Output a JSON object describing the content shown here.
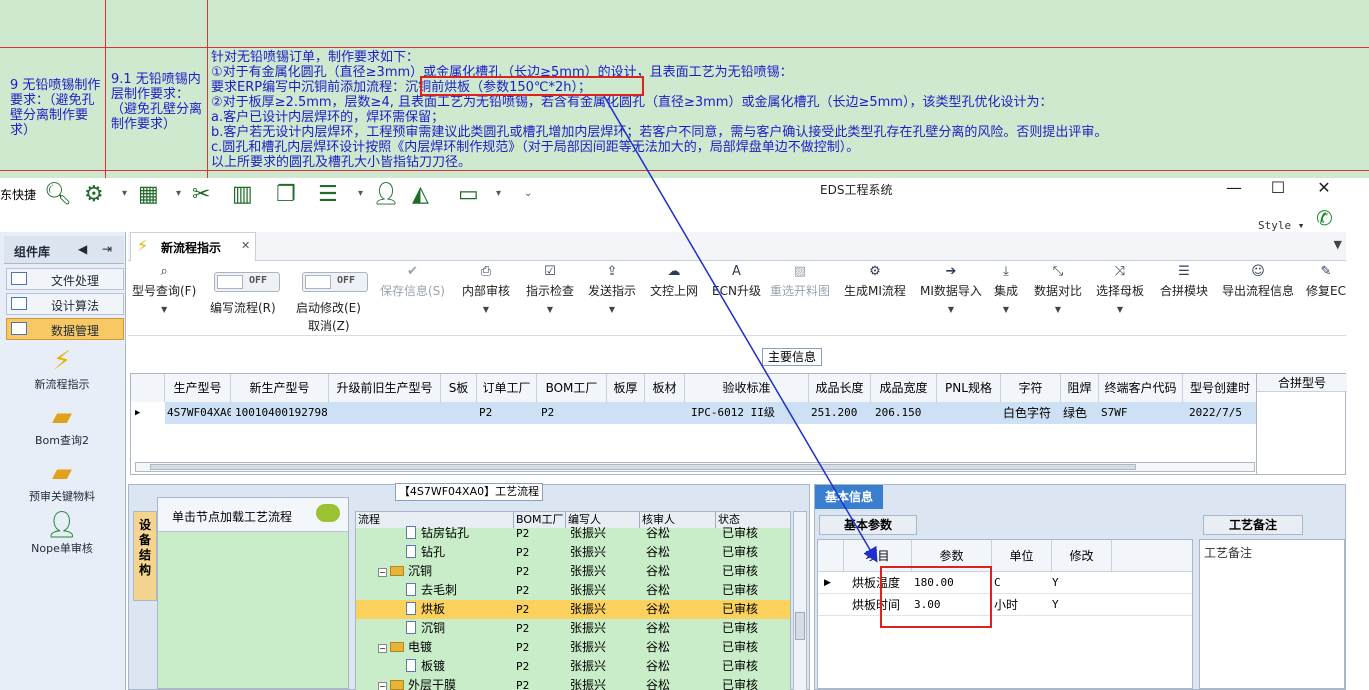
{
  "sheet": {
    "col1_text": "9 无铅喷锡制作要求：（避免孔壁分离制作要求）",
    "col2_text": "9.1 无铅喷锡内层制作要求：（避免孔壁分离制作要求）",
    "lines": [
      "针对无铅喷锡订单，制作要求如下：",
      "①对于有金属化圆孔（直径≥3mm）或金属化槽孔（长边≥5mm）的设计，且表面工艺为无铅喷锡：",
      "要求ERP编写中沉铜前添加流程：沉铜前烘板（参数150℃*2h）；",
      "②对于板厚≥2.5mm，层数≥4, 且表面工艺为无铅喷锡，若含有金属化圆孔（直径≥3mm）或金属化槽孔（长边≥5mm），该类型孔优化设计为：",
      "a.客户已设计内层焊环的，焊环需保留；",
      "b.客户若无设计内层焊环，工程预审需建议此类圆孔或槽孔增加内层焊环；若客户不同意，需与客户确认接受此类型孔存在孔壁分离的风险。否则提出评审。",
      "c.圆孔和槽孔内层焊环设计按照《内层焊环制作规范》（对于局部因间距等无法加大的，局部焊盘单边不做控制）。",
      "以上所要求的圆孔及槽孔大小皆指钻刀刀径。"
    ]
  },
  "window": {
    "quick_label": "东快捷",
    "title": "EDS工程系统",
    "style_label": "Style"
  },
  "left_panel": {
    "title": "组件库",
    "categories": [
      "文件处理",
      "设计算法",
      "数据管理"
    ],
    "items": [
      "新流程指示",
      "Bom查询2",
      "预审关键物料",
      "Nope单审核"
    ]
  },
  "tab": {
    "label": "新流程指示"
  },
  "toolbar": {
    "query": "型号查询(F)",
    "write_flow": "编写流程(R)",
    "start_edit": "启动修改(E)",
    "cancel": "取消(Z)",
    "off": "OFF",
    "save": "保存信息(S)",
    "internal_review": "内部审核",
    "indicator_check": "指示检查",
    "send": "发送指示",
    "upload": "文控上网",
    "ecn": "ECN升级",
    "reselect": "重选开料图",
    "gen_mi": "生成MI流程",
    "mi_import": "MI数据导入",
    "integrate": "集成",
    "compare": "数据对比",
    "select_board": "选择母板",
    "combine": "合拼模块",
    "export": "导出流程信息",
    "modify_e": "修复EC"
  },
  "main_info": {
    "label": "主要信息",
    "headers": [
      "生产型号",
      "新生产型号",
      "升级前旧生产型号",
      "S板",
      "订单工厂",
      "BOM工厂",
      "板厚",
      "板材",
      "验收标准",
      "成品长度",
      "成品宽度",
      "PNL规格",
      "字符",
      "阻焊",
      "终端客户代码",
      "型号创建时"
    ],
    "row": [
      "4S7WF04XA0",
      "10010400192798",
      "",
      "",
      "P2",
      "P2",
      "",
      "",
      "IPC-6012 II级",
      "251.200",
      "206.150",
      "",
      "白色字符",
      "绿色",
      "S7WF",
      "2022/7/5"
    ],
    "combo_label": "合拼型号"
  },
  "flow": {
    "title": "【4S7WF04XA0】工艺流程",
    "vtab": "设备结构",
    "node_hint": "单击节点加载工艺流程",
    "headers": [
      "流程",
      "BOM工厂",
      "编写人",
      "核审人",
      "状态"
    ],
    "rows": [
      {
        "name": "钻房钻孔",
        "bom": "P2",
        "writer": "张振兴",
        "reviewer": "谷松",
        "status": "已审核",
        "kind": "doc",
        "indent": 1
      },
      {
        "name": "钻孔",
        "bom": "P2",
        "writer": "张振兴",
        "reviewer": "谷松",
        "status": "已审核",
        "kind": "doc",
        "indent": 1
      },
      {
        "name": "沉铜",
        "bom": "P2",
        "writer": "张振兴",
        "reviewer": "谷松",
        "status": "已审核",
        "kind": "folder",
        "indent": 0
      },
      {
        "name": "去毛刺",
        "bom": "P2",
        "writer": "张振兴",
        "reviewer": "谷松",
        "status": "已审核",
        "kind": "doc",
        "indent": 1
      },
      {
        "name": "烘板",
        "bom": "P2",
        "writer": "张振兴",
        "reviewer": "谷松",
        "status": "已审核",
        "kind": "doc",
        "indent": 1
      },
      {
        "name": "沉铜",
        "bom": "P2",
        "writer": "张振兴",
        "reviewer": "谷松",
        "status": "已审核",
        "kind": "doc",
        "indent": 1
      },
      {
        "name": "电镀",
        "bom": "P2",
        "writer": "张振兴",
        "reviewer": "谷松",
        "status": "已审核",
        "kind": "folder",
        "indent": 0
      },
      {
        "name": "板镀",
        "bom": "P2",
        "writer": "张振兴",
        "reviewer": "谷松",
        "status": "已审核",
        "kind": "doc",
        "indent": 1
      },
      {
        "name": "外层干膜",
        "bom": "P2",
        "writer": "张振兴",
        "reviewer": "谷松",
        "status": "已审核",
        "kind": "folder",
        "indent": 0
      }
    ]
  },
  "basic": {
    "tab": "基本信息",
    "params_tab": "基本参数",
    "headers": [
      "项目",
      "参数",
      "单位",
      "修改"
    ],
    "rows": [
      {
        "item": "烘板温度",
        "value": "180.00",
        "unit": "C",
        "mod": "Y"
      },
      {
        "item": "烘板时间",
        "value": "3.00",
        "unit": "小时",
        "mod": "Y"
      }
    ],
    "remark_tab": "工艺备注",
    "remark_label": "工艺备注"
  },
  "colors": {
    "accent": "#3a7fcf",
    "annotation_red": "#d22222",
    "arrow_blue": "#1e2fd0",
    "sheet_green": "#cfe9cf"
  }
}
